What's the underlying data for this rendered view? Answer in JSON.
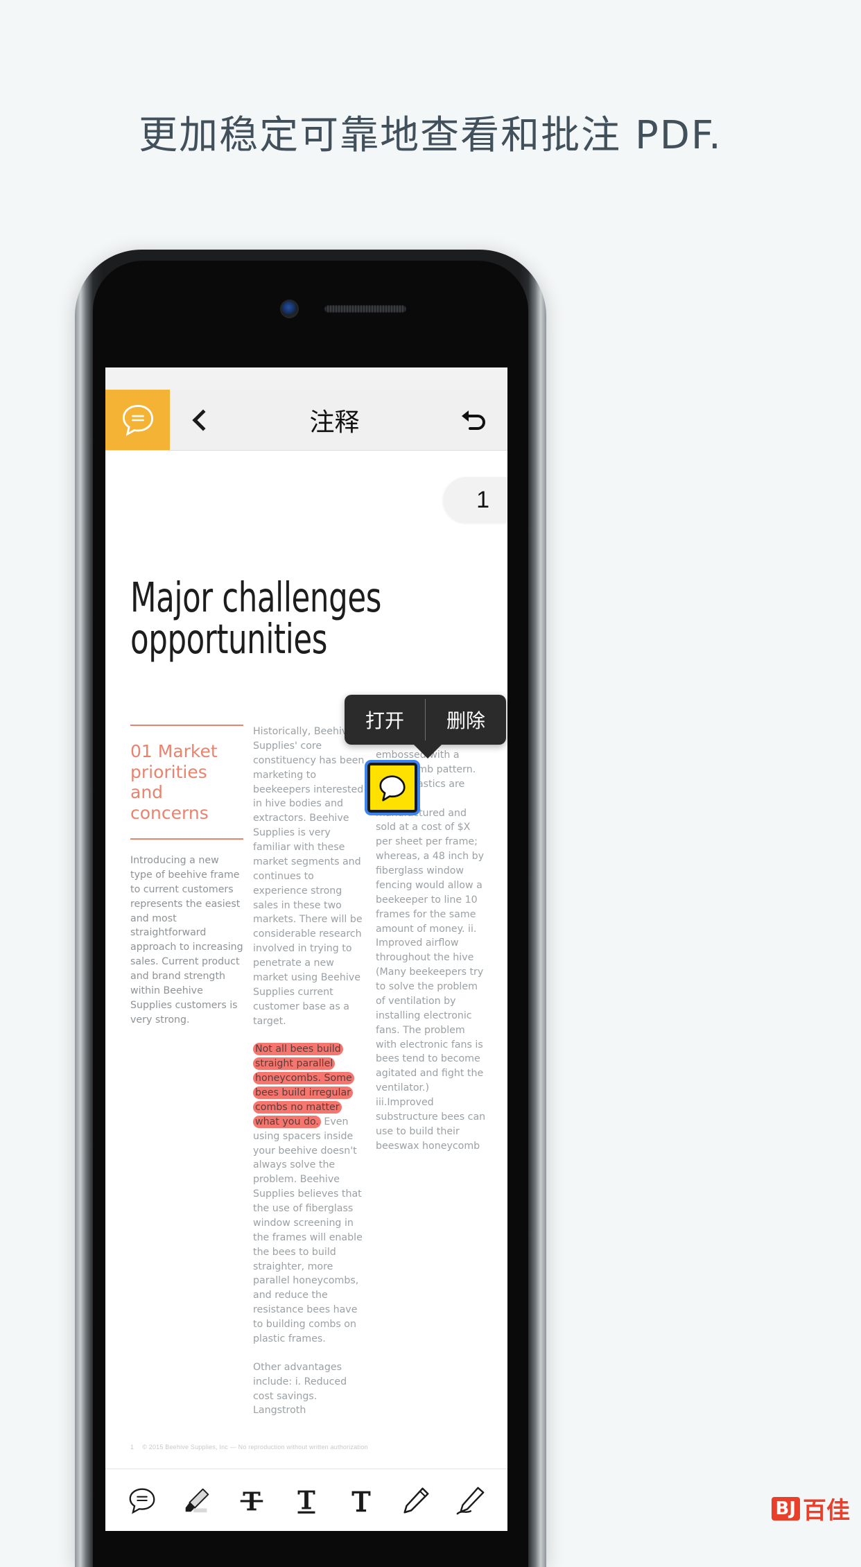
{
  "headline": "更加稳定可靠地查看和批注 PDF.",
  "colors": {
    "page_background": "#f4f7f8",
    "headline_text": "#41505a",
    "accent_orange": "#f5b335",
    "doc_accent_coral": "#e8836d",
    "highlight_red": "#f4766e",
    "note_yellow": "#ffe100",
    "selection_blue": "#3b84f0",
    "popup_dark": "#2b2b2b",
    "watermark_red": "#e8402a"
  },
  "appbar": {
    "badge_icon": "comment-bubble-icon",
    "back_icon": "chevron-left-icon",
    "title": "注释",
    "undo_icon": "undo-arrow-icon"
  },
  "document": {
    "page_badge": "1",
    "title": "Major challenges opportunities",
    "columns": {
      "left": {
        "section_heading": "01 Market priorities and concerns",
        "body": "Introducing a new type of beehive frame to current customers represents the easiest and most straightforward approach to increasing sales. Current product and brand strength within Beehive Supplies customers is very strong."
      },
      "middle": {
        "para1": "Historically, Beehive Supplies' core constituency has been marketing to beekeepers interested in hive bodies and extractors. Beehive Supplies is very familiar with these market segments and continues to experience strong sales in these two markets. There will be considerable research involved in trying to penetrate a new market using Beehive Supplies current customer base as a target.",
        "highlighted": "Not all bees build straight parallel honeycombs. Some bees build irregular combs no matter what you do.",
        "para2_rest": " Even using spacers inside your beehive doesn't always solve the problem. Beehive Supplies believes that the use of fiberglass window screening in the frames will enable the bees to build straighter, more parallel honeycombs, and reduce the resistance bees have to building combs on plastic frames.",
        "para3": "Other advantages include: i. Reduced cost savings. Langstroth"
      },
      "right": {
        "body": "embossed with a honeycomb pattern. These plastics are specially manufactured and sold at a cost of $X per sheet per frame; whereas, a 48 inch by fiberglass window fencing would allow a beekeeper to line 10 frames for the same amount of money. ii. Improved airflow throughout the hive (Many beekeepers try to solve the problem of ventilation by installing electronic fans. The problem with electronic fans is bees tend to become agitated and fight the ventilator.) iii.Improved substructure bees can use to build their beeswax honeycomb"
      }
    },
    "footer": {
      "page_number": "1",
      "copyright": "© 2015 Beehive Supplies, Inc — No reproduction without written authorization"
    }
  },
  "popup_menu": {
    "items": [
      {
        "label": "打开",
        "name": "open"
      },
      {
        "label": "删除",
        "name": "delete"
      }
    ]
  },
  "annotation": {
    "type": "sticky-note",
    "icon": "note-bubble-icon",
    "selected": true
  },
  "toolbar": {
    "tools": [
      {
        "name": "comment-tool",
        "icon": "comment-bubble-icon"
      },
      {
        "name": "highlighter-tool",
        "icon": "highlighter-pen-icon"
      },
      {
        "name": "strikethrough-tool",
        "icon": "strikethrough-text-icon"
      },
      {
        "name": "underline-tool",
        "icon": "underline-text-icon"
      },
      {
        "name": "text-tool",
        "icon": "text-icon"
      },
      {
        "name": "pencil-tool",
        "icon": "pencil-icon"
      },
      {
        "name": "signature-tool",
        "icon": "signature-pen-icon"
      }
    ]
  },
  "watermark": {
    "badge": "BJ",
    "text": "百佳"
  }
}
